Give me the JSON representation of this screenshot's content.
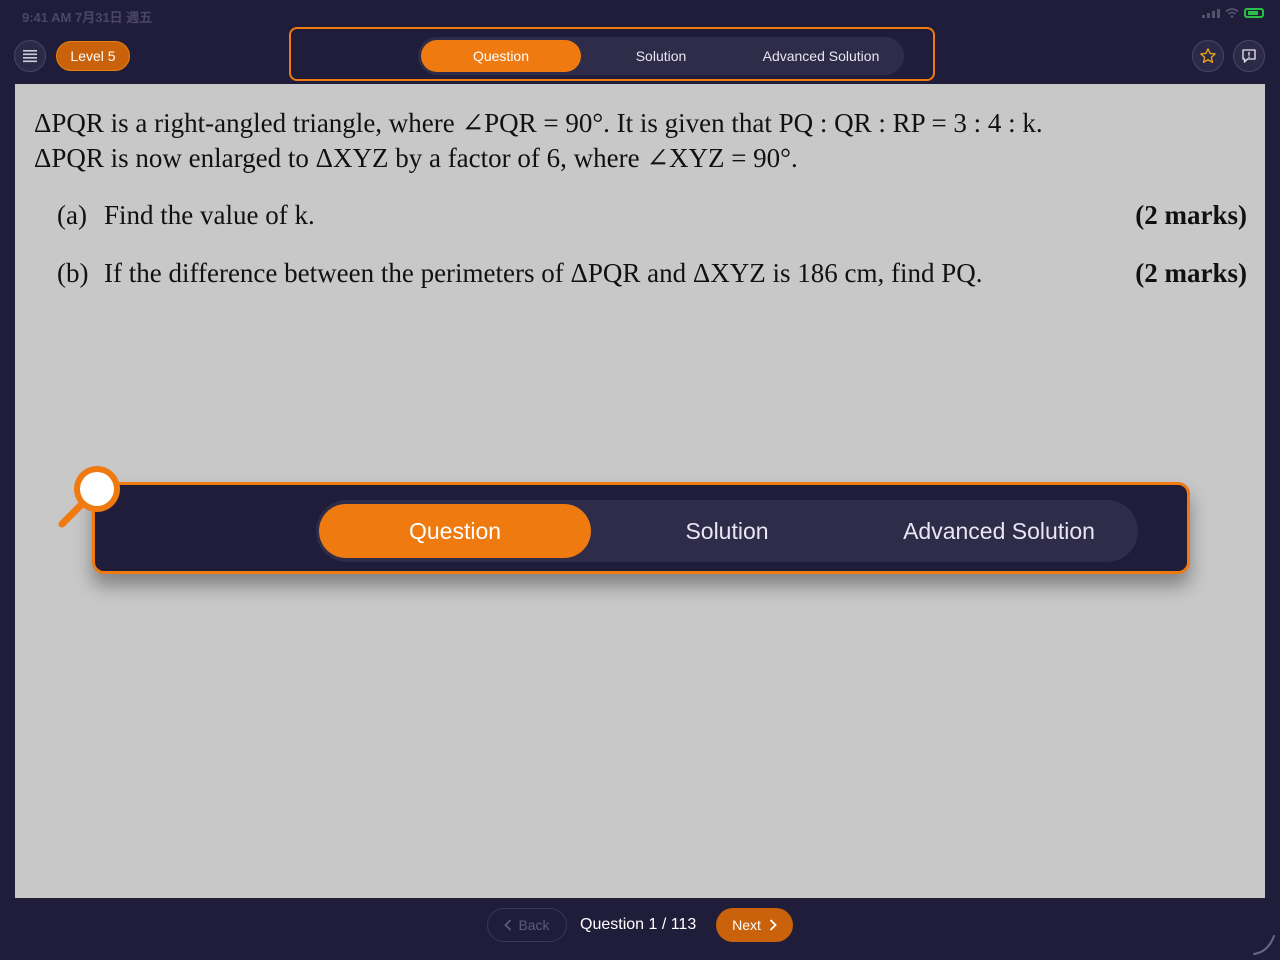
{
  "status_bar": {
    "time": "9:41 AM  7月31日 週五"
  },
  "header": {
    "level_badge": "Level 5",
    "tabs": [
      {
        "label": "Question",
        "active": true
      },
      {
        "label": "Solution",
        "active": false
      },
      {
        "label": "Advanced Solution",
        "active": false
      }
    ],
    "icons": {
      "menu": "menu-icon",
      "star": "star-icon",
      "feedback": "feedback-icon"
    }
  },
  "question": {
    "stem_line1": "ΔPQR is a right-angled triangle, where ∠PQR = 90°. It is given that PQ : QR : RP = 3 : 4 : k.",
    "stem_line2": "ΔPQR is now enlarged to ΔXYZ by a factor of 6, where ∠XYZ = 90°.",
    "parts": [
      {
        "label": "(a)",
        "text": "Find the value of k.",
        "marks": "(2 marks)"
      },
      {
        "label": "(b)",
        "text": "If the difference between the perimeters of ΔPQR and ΔXYZ is 186 cm, find PQ.",
        "marks": "(2 marks)"
      }
    ]
  },
  "zoom_overlay": {
    "tabs": [
      {
        "label": "Question",
        "active": true
      },
      {
        "label": "Solution",
        "active": false
      },
      {
        "label": "Advanced Solution",
        "active": false
      }
    ]
  },
  "footer": {
    "back_label": "Back",
    "counter": "Question 1 / 113",
    "next_label": "Next"
  },
  "colors": {
    "accent": "#ee7a10",
    "badge": "#c9620a",
    "background": "#201d3a",
    "content_bg": "#c8c8c8"
  }
}
